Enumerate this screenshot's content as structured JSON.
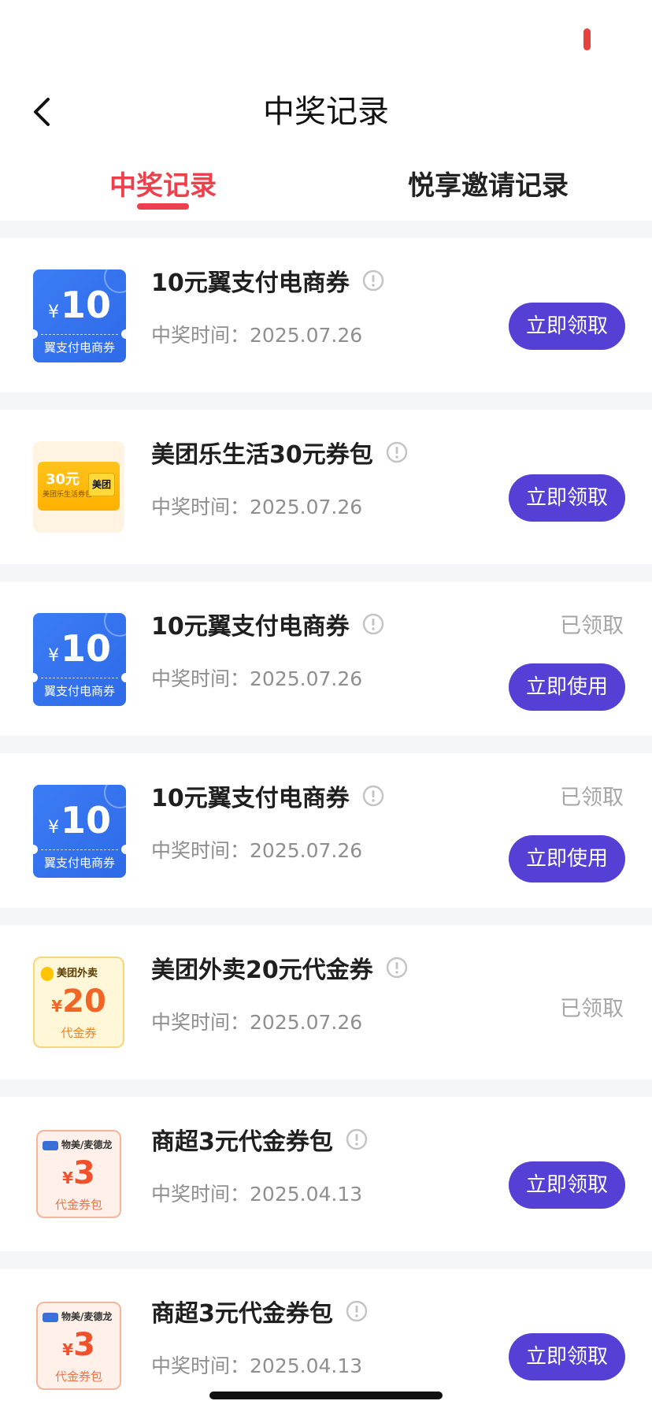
{
  "header": {
    "title": "中奖记录"
  },
  "tabs": [
    {
      "label": "中奖记录",
      "active": true
    },
    {
      "label": "悦享邀请记录",
      "active": false
    }
  ],
  "colors": {
    "accent_red": "#ee3f4d",
    "button_purple": "#5540d6",
    "muted_text": "#8f8f8f"
  },
  "time_prefix": "中奖时间：",
  "records": [
    {
      "title": "10元翼支付电商券",
      "time": "2025.07.26",
      "status": "",
      "action": "立即领取",
      "thumb": {
        "kind": "blue",
        "yen": "¥",
        "amount": "10",
        "label": "翼支付电商券"
      }
    },
    {
      "title": "美团乐生活30元券包",
      "time": "2025.07.26",
      "status": "",
      "action": "立即领取",
      "thumb": {
        "kind": "meituan",
        "amount": "30元",
        "label": "美团乐生活券包",
        "brand": "美团"
      }
    },
    {
      "title": "10元翼支付电商券",
      "time": "2025.07.26",
      "status": "已领取",
      "action": "立即使用",
      "thumb": {
        "kind": "blue",
        "yen": "¥",
        "amount": "10",
        "label": "翼支付电商券"
      }
    },
    {
      "title": "10元翼支付电商券",
      "time": "2025.07.26",
      "status": "已领取",
      "action": "立即使用",
      "thumb": {
        "kind": "blue",
        "yen": "¥",
        "amount": "10",
        "label": "翼支付电商券"
      }
    },
    {
      "title": "美团外卖20元代金券",
      "time": "2025.07.26",
      "status": "已领取",
      "action": "",
      "thumb": {
        "kind": "waimai",
        "brand": "美团外卖",
        "yen": "¥",
        "amount": "20",
        "label": "代金券"
      }
    },
    {
      "title": "商超3元代金券包",
      "time": "2025.04.13",
      "status": "",
      "action": "立即领取",
      "thumb": {
        "kind": "market",
        "brand": "物美/麦德龙",
        "yen": "¥",
        "amount": "3",
        "label": "代金券包"
      }
    },
    {
      "title": "商超3元代金券包",
      "time": "2025.04.13",
      "status": "",
      "action": "立即领取",
      "thumb": {
        "kind": "market",
        "brand": "物美/麦德龙",
        "yen": "¥",
        "amount": "3",
        "label": "代金券包"
      }
    }
  ]
}
